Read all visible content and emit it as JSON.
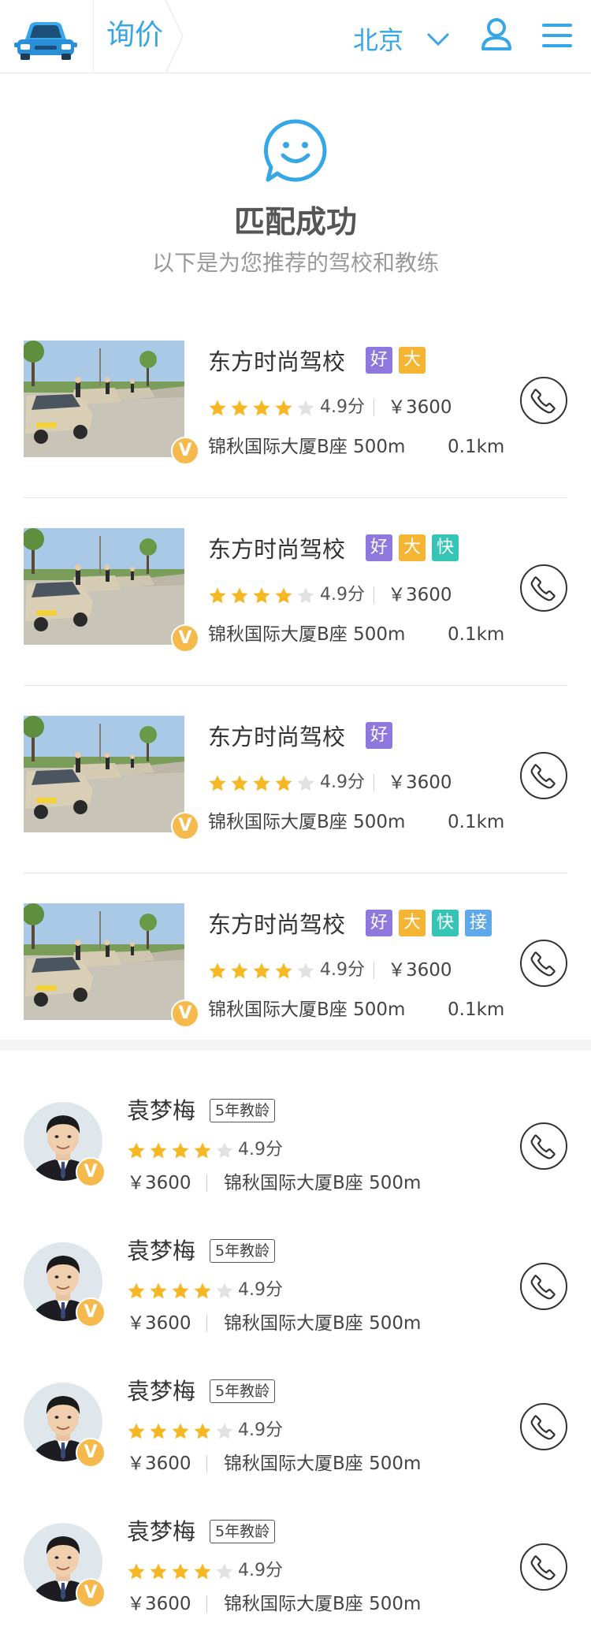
{
  "header": {
    "title": "询价",
    "city": "北京",
    "accent_color": "#35a6e6",
    "icons": [
      "car-logo-icon",
      "chevron-down-icon",
      "user-icon",
      "menu-icon"
    ]
  },
  "success": {
    "icon": "smile-chat-icon",
    "title": "匹配成功",
    "subtitle": "以下是为您推荐的驾校和教练"
  },
  "tag_colors": {
    "好": "#8e78dd",
    "大": "#f3b533",
    "快": "#36c5b5",
    "接": "#5fa8ea"
  },
  "schools": [
    {
      "name": "东方时尚驾校",
      "tags": [
        "好",
        "大"
      ],
      "stars": 4,
      "rating": "4.9分",
      "price": "￥3600",
      "address": "锦秋国际大厦B座 500m",
      "distance": "0.1km",
      "verified": "V"
    },
    {
      "name": "东方时尚驾校",
      "tags": [
        "好",
        "大",
        "快"
      ],
      "stars": 4,
      "rating": "4.9分",
      "price": "￥3600",
      "address": "锦秋国际大厦B座 500m",
      "distance": "0.1km",
      "verified": "V"
    },
    {
      "name": "东方时尚驾校",
      "tags": [
        "好"
      ],
      "stars": 4,
      "rating": "4.9分",
      "price": "￥3600",
      "address": "锦秋国际大厦B座 500m",
      "distance": "0.1km",
      "verified": "V"
    },
    {
      "name": "东方时尚驾校",
      "tags": [
        "好",
        "大",
        "快",
        "接"
      ],
      "stars": 4,
      "rating": "4.9分",
      "price": "￥3600",
      "address": "锦秋国际大厦B座 500m",
      "distance": "0.1km",
      "verified": "V"
    }
  ],
  "coaches": [
    {
      "name": "袁梦梅",
      "years": "5年教龄",
      "stars": 4,
      "rating": "4.9分",
      "price": "￥3600",
      "address": "锦秋国际大厦B座 500m",
      "verified": "V"
    },
    {
      "name": "袁梦梅",
      "years": "5年教龄",
      "stars": 4,
      "rating": "4.9分",
      "price": "￥3600",
      "address": "锦秋国际大厦B座 500m",
      "verified": "V"
    },
    {
      "name": "袁梦梅",
      "years": "5年教龄",
      "stars": 4,
      "rating": "4.9分",
      "price": "￥3600",
      "address": "锦秋国际大厦B座 500m",
      "verified": "V"
    },
    {
      "name": "袁梦梅",
      "years": "5年教龄",
      "stars": 4,
      "rating": "4.9分",
      "price": "￥3600",
      "address": "锦秋国际大厦B座 500m",
      "verified": "V"
    }
  ],
  "star_color_on": "#f5b824",
  "star_color_off": "#e2e2e2"
}
